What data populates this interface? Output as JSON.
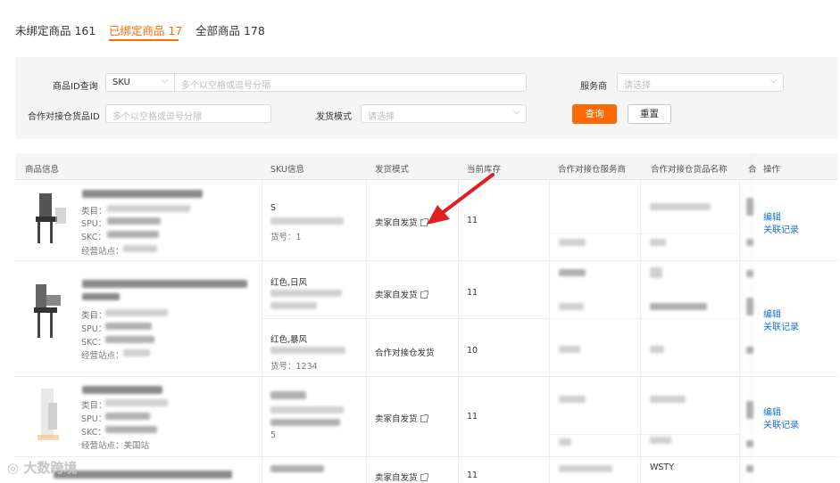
{
  "tabs": [
    {
      "label": "未绑定商品 161"
    },
    {
      "label": "已绑定商品 17"
    },
    {
      "label": "全部商品 178"
    }
  ],
  "filters": {
    "product_id_label": "商品ID查询",
    "sku_select": "SKU",
    "product_id_placeholder": "多个以空格或逗号分隔",
    "provider_label": "服务商",
    "provider_placeholder": "请选择",
    "partner_goods_id_label": "合作对接仓货品ID",
    "partner_goods_id_placeholder": "多个以空格或逗号分隔",
    "ship_mode_label": "发货模式",
    "ship_mode_placeholder": "请选择",
    "query_button": "查询",
    "reset_button": "重置"
  },
  "table": {
    "headers": [
      "商品信息",
      "SKU信息",
      "发货模式",
      "当前库存",
      "合作对接仓服务商",
      "合作对接仓货品名称",
      "合",
      "操作"
    ],
    "rows": [
      {
        "product_fields": [
          "类目：",
          "SPU：",
          "SKC：",
          "经营站点："
        ],
        "skus": [
          {
            "name": "S",
            "field": "货号：1",
            "ship_mode": "卖家自发货",
            "stock": "11"
          }
        ],
        "ops": [
          "编辑",
          "关联记录"
        ]
      },
      {
        "product_fields": [
          "类目：",
          "SPU：",
          "SKC：",
          "经营站点："
        ],
        "skus": [
          {
            "name": "红色,日风",
            "field": "",
            "ship_mode": "卖家自发货",
            "stock": "11"
          },
          {
            "name": "红色,暴风",
            "field": "货号：1234",
            "ship_mode": "合作对接仓发货",
            "stock": "10"
          }
        ],
        "ops": [
          "编辑",
          "关联记录"
        ]
      },
      {
        "product_fields": [
          "类目：",
          "SPU：",
          "SKC：",
          "经营站点：美国站"
        ],
        "skus": [
          {
            "name": "",
            "field": "5",
            "ship_mode": "卖家自发货",
            "stock": "11"
          }
        ],
        "ops": [
          "编辑",
          "关联记录"
        ]
      },
      {
        "product_fields": [],
        "skus": [
          {
            "name": "",
            "field": "",
            "ship_mode": "卖家自发货",
            "stock": "11"
          }
        ],
        "ops": []
      }
    ],
    "partner_name_visible": "WSTY"
  },
  "watermark": "大数跨境",
  "annotation_arrow_color": "#e02020",
  "accent_color": "#ff6a00",
  "link_color": "#1a73c8"
}
